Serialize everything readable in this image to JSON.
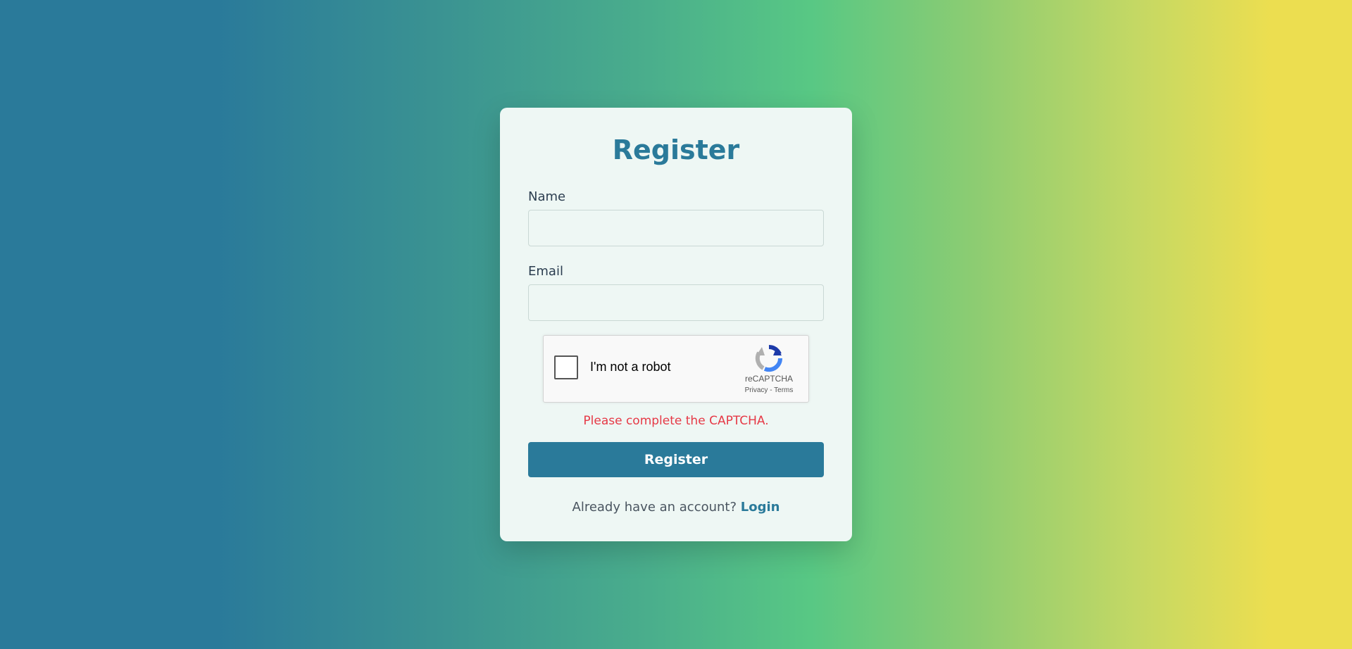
{
  "form": {
    "title": "Register",
    "name_label": "Name",
    "name_value": "",
    "email_label": "Email",
    "email_value": "",
    "submit_label": "Register",
    "error_message": "Please complete the CAPTCHA."
  },
  "captcha": {
    "label": "I'm not a robot",
    "brand": "reCAPTCHA",
    "privacy": "Privacy",
    "separator": " - ",
    "terms": "Terms",
    "checked": false
  },
  "footer": {
    "prompt": "Already have an account?",
    "link_label": "Login"
  },
  "colors": {
    "accent": "#2a7a9a",
    "error": "#e63946",
    "card_bg": "#eef7f4",
    "gradient_start": "#2a7a9a",
    "gradient_mid": "#58c884",
    "gradient_end": "#ecde50"
  },
  "icons": {
    "captcha_logo": "recaptcha-icon"
  }
}
